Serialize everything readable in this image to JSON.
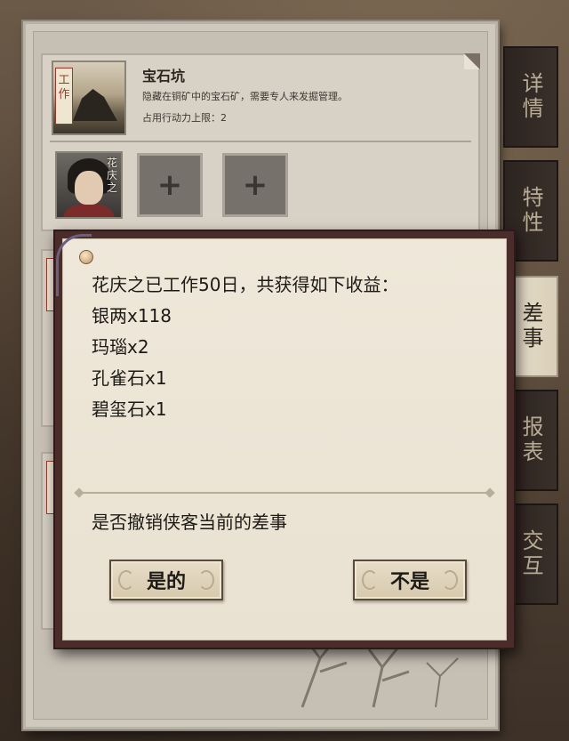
{
  "job": {
    "title": "宝石坑",
    "description": "隐藏在铜矿中的宝石矿，需要专人来发掘管理。",
    "capacity": "占用行动力上限：2",
    "tag": "工作",
    "worker_name": "花庆之",
    "add_slot_symbol": "+"
  },
  "side_tabs": [
    {
      "label": "详情",
      "active": false
    },
    {
      "label": "特性",
      "active": false
    },
    {
      "label": "差事",
      "active": true
    },
    {
      "label": "报表",
      "active": false
    },
    {
      "label": "交互",
      "active": false
    }
  ],
  "dialog": {
    "summary": "花庆之已工作50日，共获得如下收益：",
    "rewards": [
      "银两x118",
      "玛瑙x2",
      "孔雀石x1",
      "碧玺石x1"
    ],
    "question": "是否撤销侠客当前的差事",
    "confirm_label": "是的",
    "cancel_label": "不是"
  }
}
